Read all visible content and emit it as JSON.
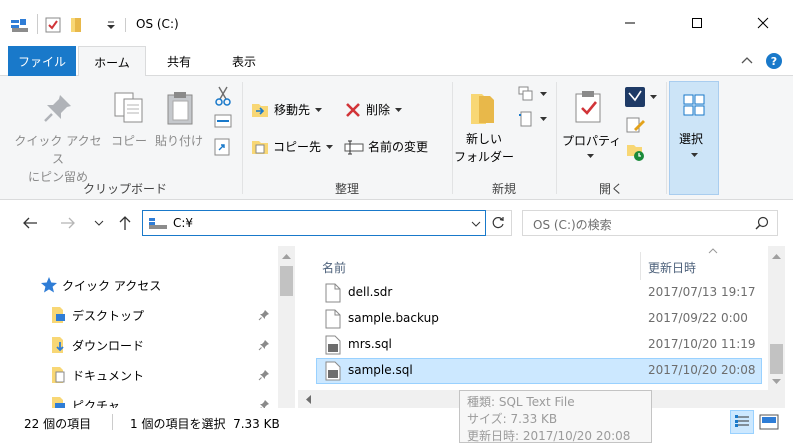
{
  "window": {
    "title": "OS (C:)"
  },
  "ribbon_tabs": {
    "file": "ファイル",
    "home": "ホーム",
    "share": "共有",
    "view": "表示"
  },
  "clipboard": {
    "pin": [
      "クイック アクセス",
      "にピン留め"
    ],
    "copy": "コピー",
    "paste": "貼り付け",
    "label": "クリップボード"
  },
  "organize": {
    "move_to": "移動先",
    "delete": "削除",
    "copy_to": "コピー先",
    "rename": "名前の変更",
    "label": "整理"
  },
  "new": {
    "new_folder": [
      "新しい",
      "フォルダー"
    ],
    "label": "新規"
  },
  "open": {
    "properties": "プロパティ",
    "label": "開く"
  },
  "select": {
    "select": "選択"
  },
  "address": {
    "path": "C:¥",
    "search_placeholder": "OS (C:)の検索"
  },
  "nav_pane": {
    "items": [
      {
        "label": "クイック アクセス"
      },
      {
        "label": "デスクトップ"
      },
      {
        "label": "ダウンロード"
      },
      {
        "label": "ドキュメント"
      },
      {
        "label": "ピクチャ"
      }
    ]
  },
  "file_list": {
    "columns": {
      "name": "名前",
      "date": "更新日時"
    },
    "rows": [
      {
        "name": "dell.sdr",
        "date": "2017/07/13 19:17"
      },
      {
        "name": "sample.backup",
        "date": "2017/09/22 0:00"
      },
      {
        "name": "mrs.sql",
        "date": "2017/10/20 11:19"
      },
      {
        "name": "sample.sql",
        "date": "2017/10/20 20:08"
      }
    ]
  },
  "status": {
    "item_count": "22 個の項目",
    "selected": "1 個の項目を選択  7.33 KB"
  },
  "tooltip": {
    "type": "種類: SQL Text File",
    "size": "サイズ: 7.33 KB",
    "date": "更新日時: 2017/10/20 20:08"
  },
  "colors": {
    "accent": "#1979ca",
    "selection": "#cce8ff"
  }
}
